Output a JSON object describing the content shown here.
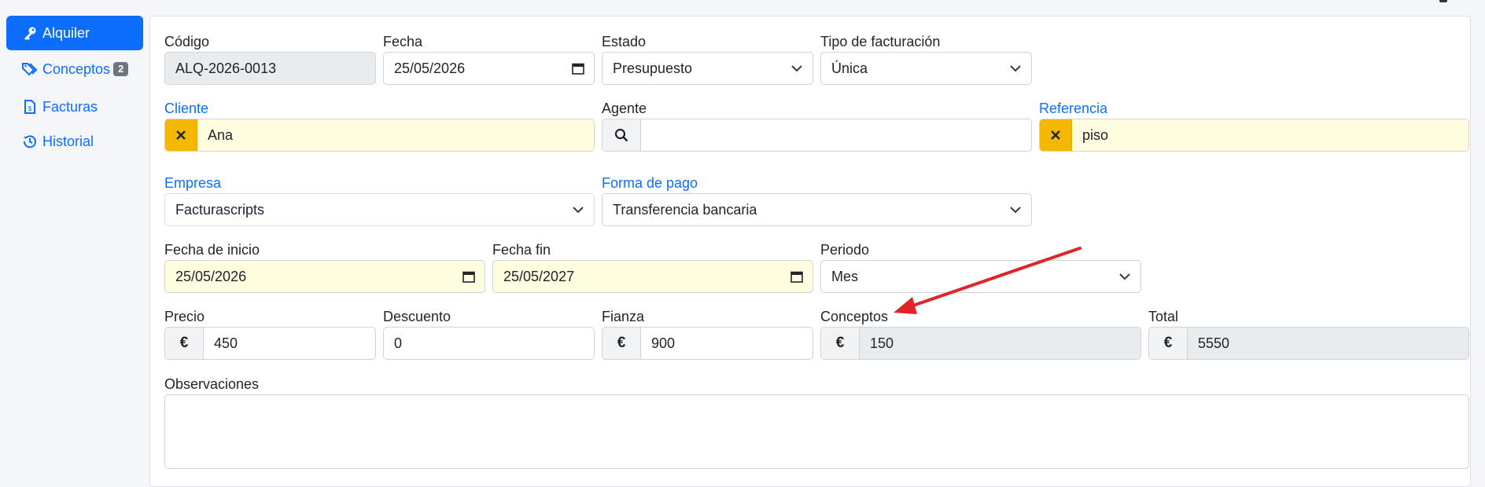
{
  "sidebar": {
    "items": [
      {
        "label": "Alquiler",
        "active": true,
        "icon": "key-icon"
      },
      {
        "label": "Conceptos",
        "badge": "2",
        "icon": "tags-icon"
      },
      {
        "label": "Facturas",
        "icon": "invoice-file-icon"
      },
      {
        "label": "Historial",
        "icon": "history-icon"
      }
    ]
  },
  "form": {
    "codigo": {
      "label": "Código",
      "value": "ALQ-2026-0013"
    },
    "fecha": {
      "label": "Fecha",
      "value": "25/05/2026"
    },
    "estado": {
      "label": "Estado",
      "value": "Presupuesto"
    },
    "tipo_facturacion": {
      "label": "Tipo de facturación",
      "value": "Única"
    },
    "cliente": {
      "label": "Cliente",
      "value": "Ana"
    },
    "agente": {
      "label": "Agente",
      "value": ""
    },
    "referencia": {
      "label": "Referencia",
      "value": "piso"
    },
    "empresa": {
      "label": "Empresa",
      "value": "Facturascripts"
    },
    "forma_pago": {
      "label": "Forma de pago",
      "value": "Transferencia bancaria"
    },
    "fecha_inicio": {
      "label": "Fecha de inicio",
      "value": "25/05/2026"
    },
    "fecha_fin": {
      "label": "Fecha fin",
      "value": "25/05/2027"
    },
    "periodo": {
      "label": "Periodo",
      "value": "Mes"
    },
    "precio": {
      "label": "Precio",
      "value": "450",
      "currency": "€"
    },
    "descuento": {
      "label": "Descuento",
      "value": "0"
    },
    "fianza": {
      "label": "Fianza",
      "value": "900",
      "currency": "€"
    },
    "conceptos": {
      "label": "Conceptos",
      "value": "150",
      "currency": "€"
    },
    "total": {
      "label": "Total",
      "value": "5550",
      "currency": "€"
    },
    "observaciones": {
      "label": "Observaciones",
      "value": ""
    }
  },
  "colors": {
    "primary": "#0d6efd",
    "warning": "#f5b800",
    "highlight_field": "#fffde0",
    "annotation_arrow": "#e0252a"
  }
}
